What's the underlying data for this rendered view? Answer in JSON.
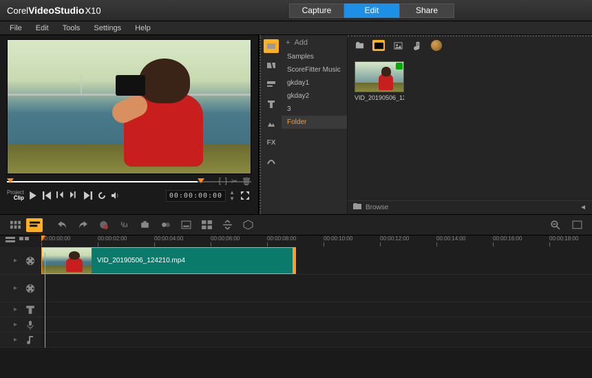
{
  "app": {
    "brand": "Corel",
    "name": "VideoStudio",
    "version": "X10"
  },
  "tabs": {
    "capture": "Capture",
    "edit": "Edit",
    "share": "Share",
    "active": "edit"
  },
  "menu": [
    "File",
    "Edit",
    "Tools",
    "Settings",
    "Help"
  ],
  "preview": {
    "mode_label1": "Project",
    "mode_label2": "Clip",
    "timecode": "00:00:00:00"
  },
  "library": {
    "add_label": "Add",
    "folders": [
      "Samples",
      "ScoreFitter Music",
      "gkday1",
      "gkday2",
      "3",
      "Folder"
    ],
    "selected_folder": "Folder",
    "browse_label": "Browse",
    "clip": {
      "name": "VID_20190506_124210..."
    }
  },
  "timeline": {
    "marks": [
      "00:00:00:00",
      "00:00:02:00",
      "00:00:04:00",
      "00:00:06:00",
      "00:00:08:00",
      "00:00:10:00",
      "00:00:12:00",
      "00:00:14:00",
      "00:00:16:00",
      "00:00:18:00"
    ],
    "clip_name": "VID_20190506_124210.mp4"
  }
}
